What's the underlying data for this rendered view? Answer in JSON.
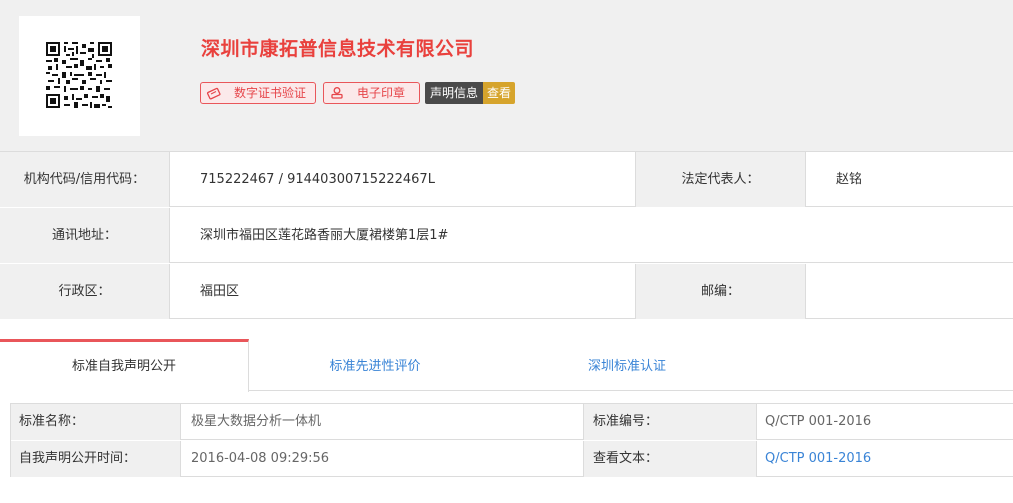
{
  "company": {
    "name": "深圳市康拓普信息技术有限公司",
    "badges": {
      "cert_label": "数字证书验证",
      "seal_label": "电子印章",
      "statement_label": "声明信息",
      "view_label": "查看"
    }
  },
  "info": {
    "org_code_label": "机构代码/信用代码：",
    "org_code_value": "715222467 / 91440300715222467L",
    "legal_rep_label": "法定代表人：",
    "legal_rep_value": "赵铭",
    "address_label": "通讯地址：",
    "address_value": "深圳市福田区莲花路香丽大厦裙楼第1层1#",
    "district_label": "行政区：",
    "district_value": "福田区",
    "postcode_label": "邮编：",
    "postcode_value": ""
  },
  "tabs": [
    {
      "label": "标准自我声明公开",
      "active": true
    },
    {
      "label": "标准先进性评价",
      "active": false
    },
    {
      "label": "深圳标准认证",
      "active": false
    }
  ],
  "standard": {
    "name_label": "标准名称：",
    "name_value": "极星大数据分析一体机",
    "number_label": "标准编号：",
    "number_value": "Q/CTP 001-2016",
    "time_label": "自我声明公开时间：",
    "time_value": "2016-04-08 09:29:56",
    "text_label": "查看文本：",
    "text_value": "Q/CTP 001-2016"
  },
  "colors": {
    "brand_red": "#e9413d",
    "link_blue": "#3a84d6",
    "view_gold": "#d6a42c",
    "header_bg": "#f0f0f0"
  },
  "icons": [
    "qr-code-icon",
    "certificate-icon",
    "seal-icon"
  ]
}
